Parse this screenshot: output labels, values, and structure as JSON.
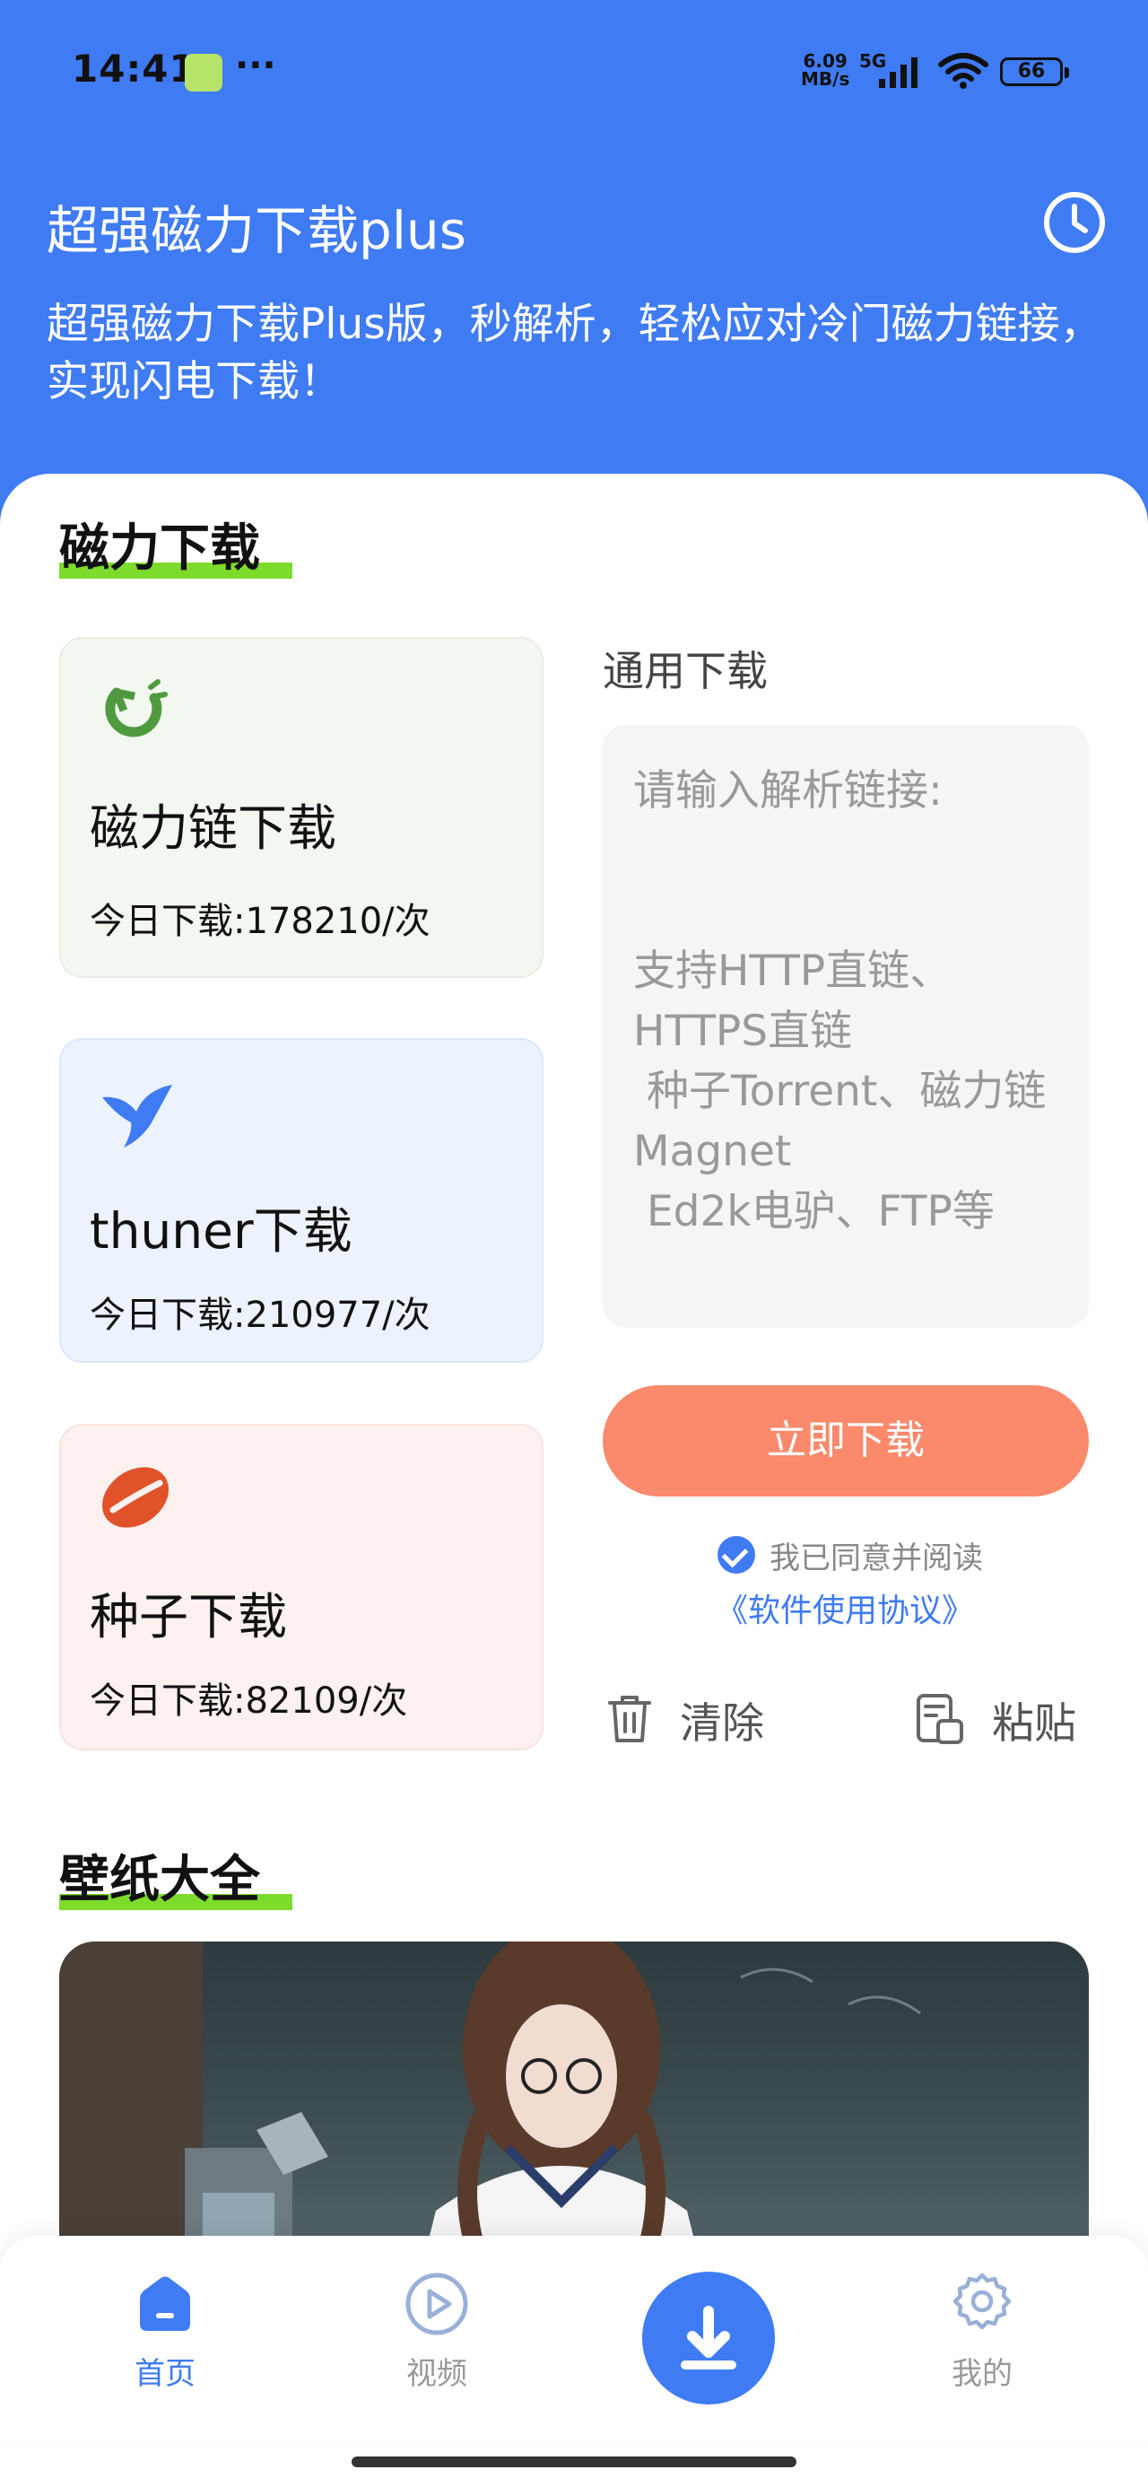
{
  "status_bar": {
    "time": "14:41",
    "more": "···",
    "speed_value": "6.09",
    "speed_unit": "MB/s",
    "network": "5G",
    "battery": "66"
  },
  "header": {
    "title": "超强磁力下载plus",
    "subtitle": "超强磁力下载Plus版，秒解析，轻松应对冷门磁力链接，实现闪电下载！"
  },
  "magnet_section": {
    "title": "磁力下载",
    "cards": [
      {
        "name": "磁力链下载",
        "count": "今日下载:178210/次",
        "icon": "magnet-icon",
        "color": "#4F9A3E"
      },
      {
        "name": "thuner下载",
        "count": "今日下载:210977/次",
        "icon": "bird-icon",
        "color": "#3F7BF3"
      },
      {
        "name": "种子下载",
        "count": "今日下载:82109/次",
        "icon": "seed-icon",
        "color": "#E0522A"
      }
    ]
  },
  "general": {
    "label": "通用下载",
    "placeholder": "请输入解析链接:\n\n\n支持HTTP直链、HTTPS直链\n 种子Torrent、磁力链Magnet\n Ed2k电驴、FTP等",
    "download_button": "立即下载",
    "agree_text": "我已同意并阅读",
    "agree_link": "《软件使用协议》",
    "clear_label": "清除",
    "paste_label": "粘贴"
  },
  "wallpaper_section": {
    "title": "壁纸大全"
  },
  "nav": {
    "home": "首页",
    "video": "视频",
    "mine": "我的"
  },
  "colors": {
    "primary": "#3F7BF3",
    "download_button": "#FB896B",
    "highlight": "#7DDB2B"
  }
}
